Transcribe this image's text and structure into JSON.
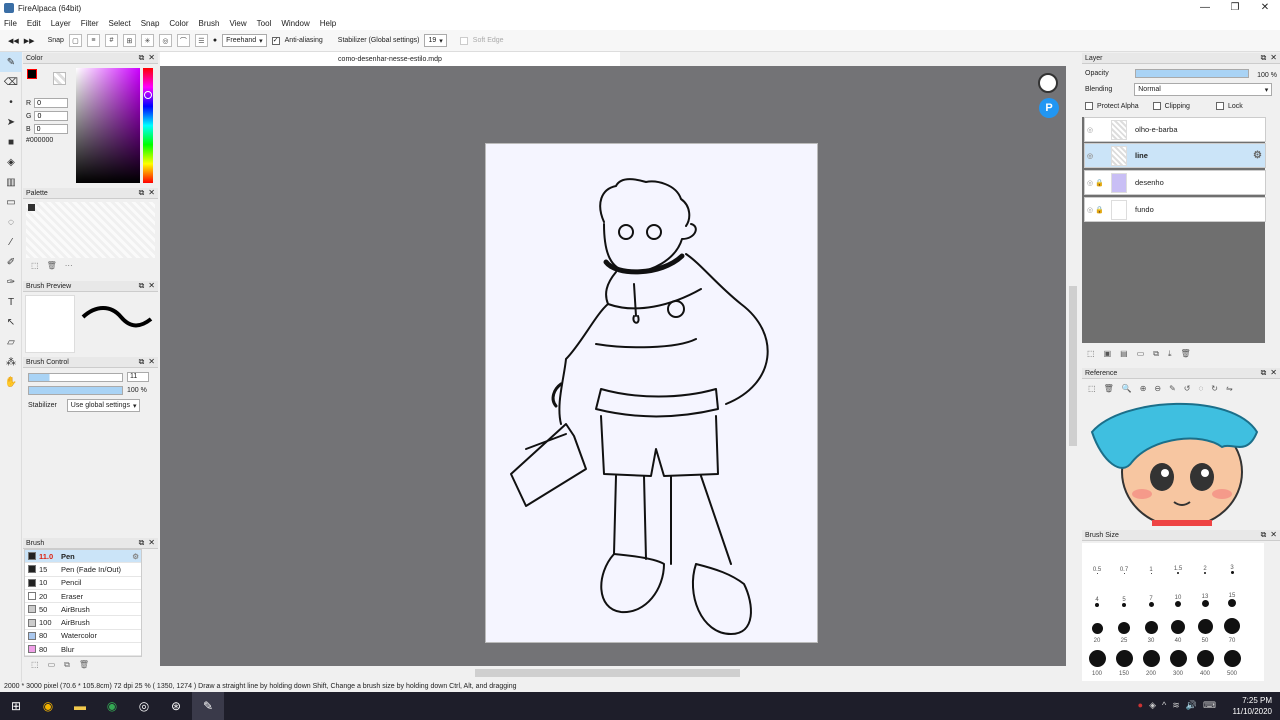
{
  "window": {
    "title": "FireAlpaca (64bit)",
    "controls": [
      "—",
      "❐",
      "✕"
    ]
  },
  "menu": [
    "File",
    "Edit",
    "Layer",
    "Filter",
    "Select",
    "Snap",
    "Color",
    "Brush",
    "View",
    "Tool",
    "Window",
    "Help"
  ],
  "toolbar": {
    "snap_label": "Snap",
    "mode": "Freehand",
    "antialias_label": "Anti-aliasing",
    "stabilizer_label": "Stabilizer (Global settings)",
    "stabilizer_value": "19",
    "soft_edge_label": "Soft Edge"
  },
  "document": {
    "tab": "como-desenhar-nesse-estilo.mdp"
  },
  "color_panel": {
    "title": "Color",
    "r_label": "R",
    "r": "0",
    "g_label": "G",
    "g": "0",
    "b_label": "B",
    "b": "0",
    "hex": "#000000"
  },
  "palette": {
    "title": "Palette",
    "more": "···"
  },
  "brush_preview": {
    "title": "Brush Preview"
  },
  "brush_control": {
    "title": "Brush Control",
    "size": "11",
    "opacity": "100 %",
    "opacity_pct": 100,
    "stabilizer_label": "Stabilizer",
    "stabilizer_value": "Use global settings"
  },
  "brush_panel": {
    "title": "Brush",
    "items": [
      {
        "size": "11.0",
        "name": "Pen",
        "color": "#222222"
      },
      {
        "size": "15",
        "name": "Pen (Fade In/Out)",
        "color": "#222222"
      },
      {
        "size": "10",
        "name": "Pencil",
        "color": "#222222"
      },
      {
        "size": "20",
        "name": "Eraser",
        "color": "#ffffff"
      },
      {
        "size": "50",
        "name": "AirBrush",
        "color": "#cccccc"
      },
      {
        "size": "100",
        "name": "AirBrush",
        "color": "#cccccc"
      },
      {
        "size": "80",
        "name": "Watercolor",
        "color": "#aac8ee"
      },
      {
        "size": "80",
        "name": "Blur",
        "color": "#f0a0e8"
      }
    ]
  },
  "layer_panel": {
    "title": "Layer",
    "opacity_label": "Opacity",
    "opacity_value": "100 %",
    "opacity_pct": 100,
    "blending_label": "Blending",
    "blending_value": "Normal",
    "protect_alpha": "Protect Alpha",
    "clipping": "Clipping",
    "lock": "Lock",
    "layers": [
      {
        "name": "olho-e-barba"
      },
      {
        "name": "line"
      },
      {
        "name": "desenho"
      },
      {
        "name": "fundo"
      }
    ]
  },
  "reference_panel": {
    "title": "Reference"
  },
  "brush_size_panel": {
    "title": "Brush Size",
    "rows": [
      [
        "0.5",
        "0.7",
        "1",
        "1.5",
        "2",
        "3"
      ],
      [
        "4",
        "5",
        "7",
        "10",
        "13",
        "15"
      ],
      [
        "20",
        "25",
        "30",
        "40",
        "50",
        "70"
      ],
      [
        "100",
        "150",
        "200",
        "300",
        "400",
        "500"
      ]
    ]
  },
  "status": {
    "text": "2000 * 3000 pixel  (70.6 * 105.8cm)  72 dpi  25 %  ( 1350, 1274 )  Draw a straight line by holding down Shift, Change a brush size by holding down Ctrl, Alt, and dragging"
  },
  "taskbar": {
    "time": "7:25 PM",
    "date": "11/10/2020"
  },
  "colors": {
    "accent": "#cbe4f8",
    "canvas_bg": "#737376",
    "paper": "#f5f5ff"
  }
}
